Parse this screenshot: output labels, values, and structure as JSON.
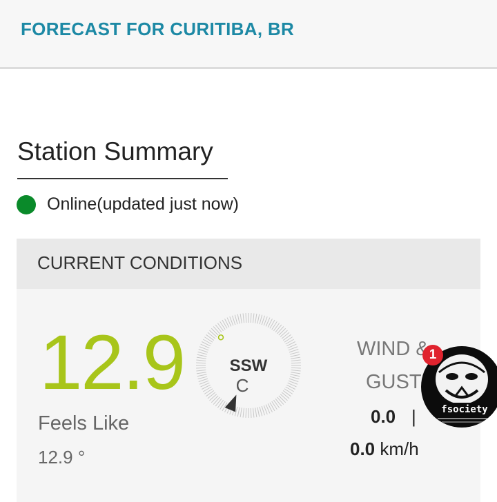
{
  "header": {
    "title": "FORECAST FOR CURITIBA, BR"
  },
  "station": {
    "section_title": "Station Summary",
    "status_text": "Online(updated just now)",
    "status_color": "#0a8a2a"
  },
  "conditions": {
    "header": "CURRENT CONDITIONS",
    "temperature": "12.9",
    "temperature_unit": "°",
    "temperature_color": "#a8c51a",
    "feels_like_label": "Feels Like",
    "feels_like_value": "12.9 °",
    "compass": {
      "direction": "SSW",
      "center_label": "C",
      "direction_degrees": 202.5
    },
    "wind": {
      "label_line1": "WIND &",
      "label_line2": "GUST",
      "wind_speed": "0.0",
      "separator": "|",
      "gust_speed": "0.0",
      "unit": "km/h"
    }
  },
  "chat_bubble": {
    "badge_count": "1",
    "label": "fsociety"
  }
}
